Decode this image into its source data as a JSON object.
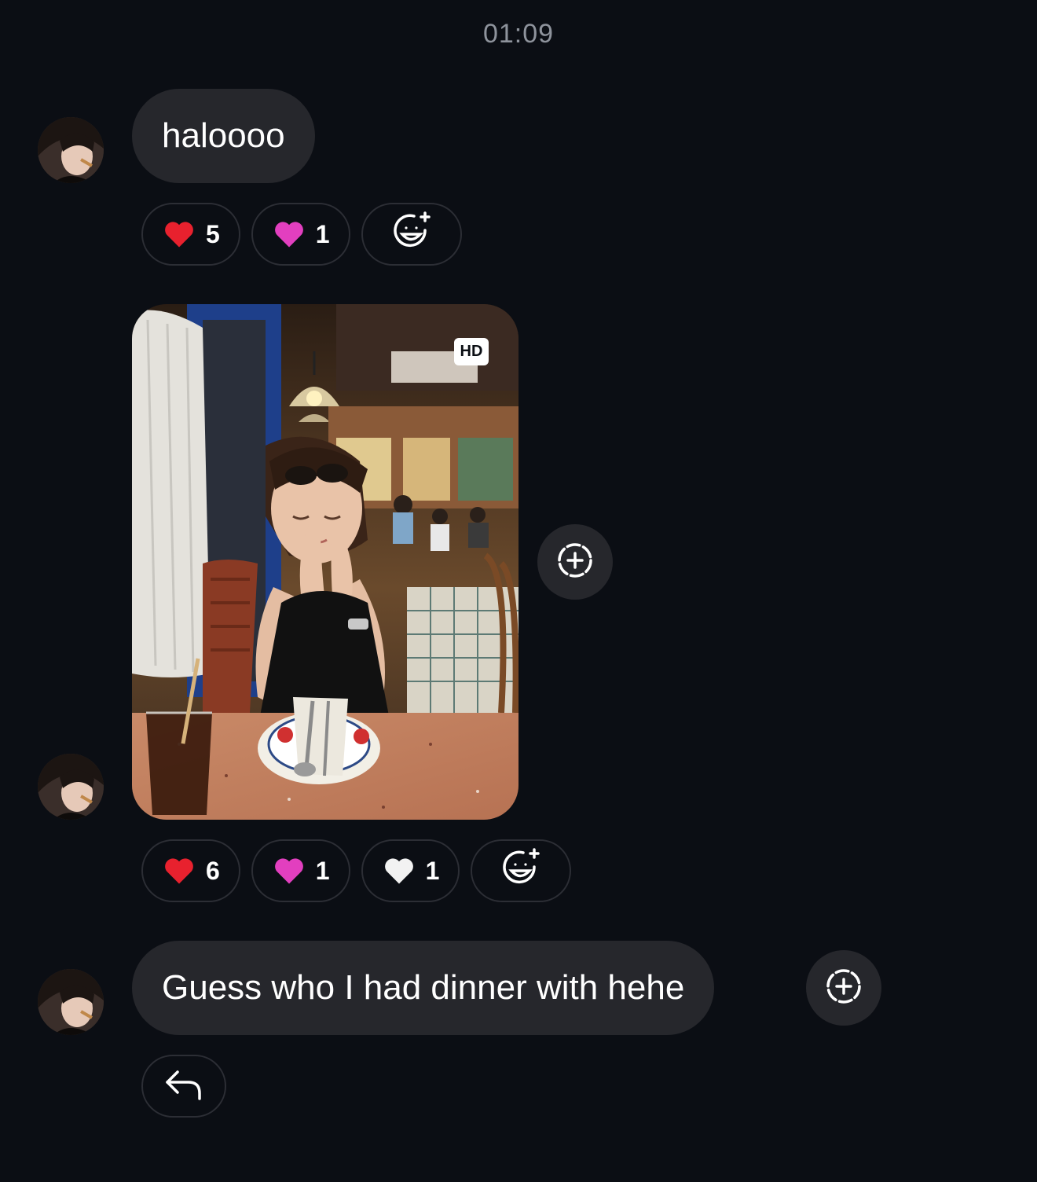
{
  "conversation": {
    "timestamp": "01:09"
  },
  "messages": [
    {
      "type": "text",
      "text": "haloooo",
      "reactions": [
        {
          "icon": "red-heart-icon",
          "count": "5"
        },
        {
          "icon": "pink-heart-icon",
          "count": "1"
        }
      ]
    },
    {
      "type": "photo",
      "badge": "HD",
      "reactions": [
        {
          "icon": "red-heart-icon",
          "count": "6"
        },
        {
          "icon": "pink-heart-icon",
          "count": "1"
        },
        {
          "icon": "white-heart-icon",
          "count": "1"
        }
      ]
    },
    {
      "type": "text",
      "text": "Guess who I had dinner with hehe"
    }
  ],
  "colors": {
    "background": "#0b0e14",
    "bubble": "#26272c",
    "timestamp": "#8e939c",
    "red_heart": "#e8212e",
    "pink_heart": "#e23fbf",
    "white_heart": "#f2f2f2"
  }
}
